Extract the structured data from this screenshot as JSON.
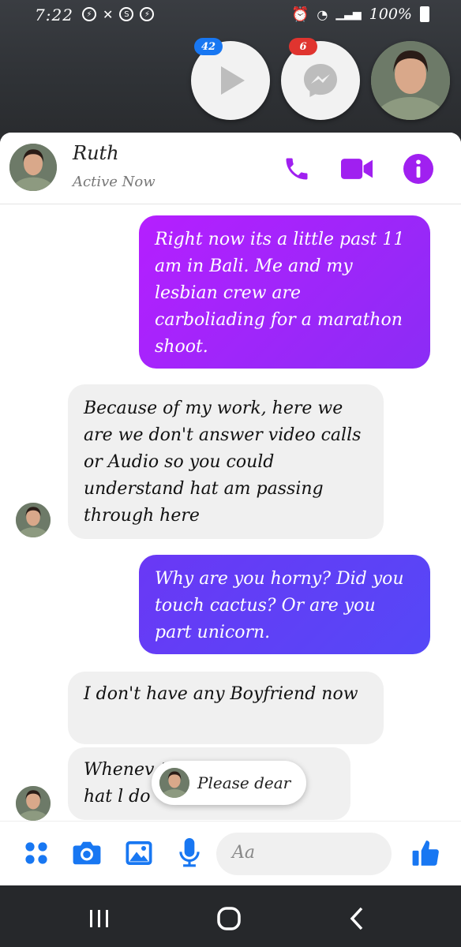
{
  "status_bar": {
    "time": "7:22",
    "battery": "100%"
  },
  "chat_heads": {
    "play_badge": "42",
    "messenger_badge": "6"
  },
  "header": {
    "contact_name": "Ruth",
    "contact_status": "Active Now"
  },
  "messages": [
    {
      "direction": "out",
      "text": "Right now its a little past 11 am in Bali. Me and my lesbian crew are carboliading for a marathon shoot."
    },
    {
      "direction": "in",
      "text": "Because of my work, here we are we don't answer video calls or Audio so you could understand hat am passing through here"
    },
    {
      "direction": "out",
      "text": "Why are you horny? Did you touch cactus? Or are you part unicorn."
    },
    {
      "direction": "in",
      "text": "I don't have any Boyfriend now"
    },
    {
      "direction": "in",
      "text": "Whenev                t's\nhat l do"
    }
  ],
  "reaction": {
    "text": "Please dear"
  },
  "composer": {
    "placeholder": "Aa"
  },
  "colors": {
    "accent_purple": "#a020f0",
    "messenger_blue": "#1877f2"
  }
}
